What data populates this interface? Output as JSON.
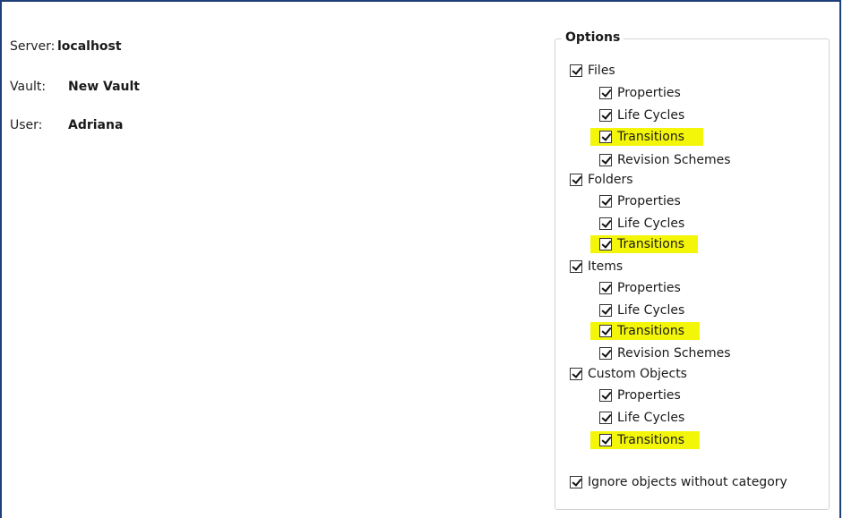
{
  "connection": {
    "server_label": "Server:",
    "server_value": "localhost",
    "vault_label": "Vault:",
    "vault_value": "New Vault",
    "user_label": "User:",
    "user_value": "Adriana"
  },
  "options": {
    "title": "Options",
    "files": {
      "label": "Files",
      "checked": true,
      "properties": "Properties",
      "life_cycles": "Life Cycles",
      "transitions": "Transitions",
      "revision_schemes": "Revision Schemes"
    },
    "folders": {
      "label": "Folders",
      "checked": true,
      "properties": "Properties",
      "life_cycles": "Life Cycles",
      "transitions": "Transitions"
    },
    "items": {
      "label": "Items",
      "checked": true,
      "properties": "Properties",
      "life_cycles": "Life Cycles",
      "transitions": "Transitions",
      "revision_schemes": "Revision Schemes"
    },
    "custom_objects": {
      "label": "Custom Objects",
      "checked": true,
      "properties": "Properties",
      "life_cycles": "Life Cycles",
      "transitions": "Transitions"
    },
    "ignore_without_category": "Ignore objects without category"
  },
  "colors": {
    "highlight": "#f4f60a",
    "frame_border": "#1f3f7a"
  }
}
